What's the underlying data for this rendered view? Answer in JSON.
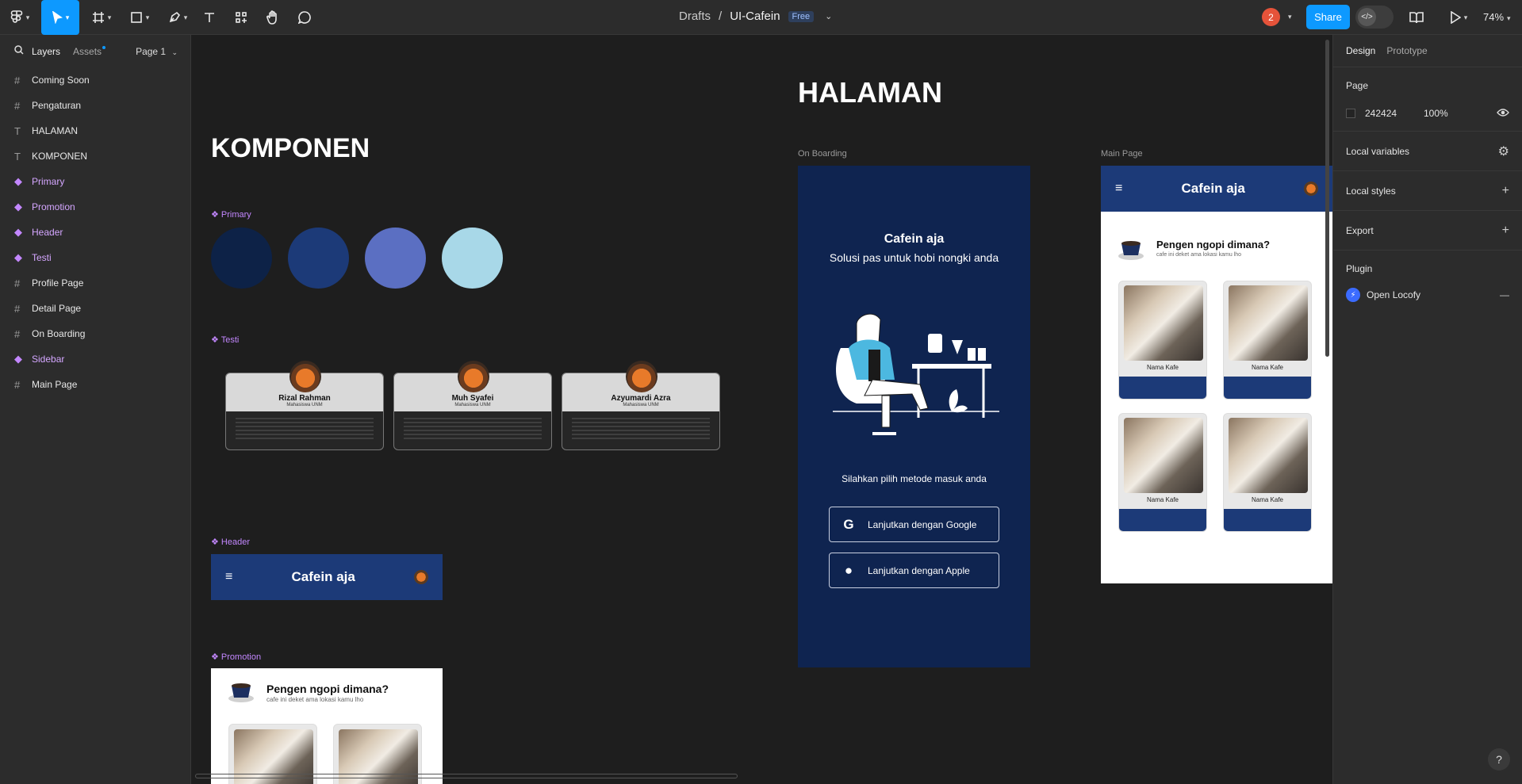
{
  "toolbar": {
    "breadcrumb_folder": "Drafts",
    "breadcrumb_sep": "/",
    "file_name": "UI-Cafein",
    "plan_badge": "Free",
    "collab_count": "2",
    "share_label": "Share",
    "zoom": "74%"
  },
  "left_panel": {
    "tabs": [
      "Layers",
      "Assets"
    ],
    "page": "Page 1",
    "layers": [
      {
        "icon": "#",
        "label": "Coming Soon",
        "kind": "frame"
      },
      {
        "icon": "#",
        "label": "Pengaturan",
        "kind": "frame"
      },
      {
        "icon": "T",
        "label": "HALAMAN",
        "kind": "text"
      },
      {
        "icon": "T",
        "label": "KOMPONEN",
        "kind": "text"
      },
      {
        "icon": "◆",
        "label": "Primary",
        "kind": "component"
      },
      {
        "icon": "◆",
        "label": "Promotion",
        "kind": "component"
      },
      {
        "icon": "◆",
        "label": "Header",
        "kind": "component"
      },
      {
        "icon": "◆",
        "label": "Testi",
        "kind": "component"
      },
      {
        "icon": "#",
        "label": "Profile Page",
        "kind": "frame"
      },
      {
        "icon": "#",
        "label": "Detail Page",
        "kind": "frame"
      },
      {
        "icon": "#",
        "label": "On Boarding",
        "kind": "frame"
      },
      {
        "icon": "◆",
        "label": "Sidebar",
        "kind": "component"
      },
      {
        "icon": "#",
        "label": "Main Page",
        "kind": "frame"
      }
    ]
  },
  "right_panel": {
    "tabs": [
      "Design",
      "Prototype"
    ],
    "page_heading": "Page",
    "page_color": "242424",
    "page_opacity": "100%",
    "local_variables": "Local variables",
    "local_styles": "Local styles",
    "export": "Export",
    "plugin_heading": "Plugin",
    "plugin_name": "Open Locofy"
  },
  "canvas": {
    "halaman_title": "HALAMAN",
    "komponen_title": "KOMPONEN",
    "primary_label": "Primary",
    "primary_colors": [
      "#0d2247",
      "#1c3a78",
      "#5b6fc2",
      "#a8d8e8"
    ],
    "testi_label": "Testi",
    "testi_cards": [
      {
        "name": "Rizal Rahman",
        "role": "Mahasiswa UNM"
      },
      {
        "name": "Muh Syafei",
        "role": "Mahasiswa UNM"
      },
      {
        "name": "Azyumardi Azra",
        "role": "Mahasiswa UNM"
      }
    ],
    "header_label": "Header",
    "header_title": "Cafein aja",
    "promotion_label": "Promotion",
    "promo_title": "Pengen ngopi dimana?",
    "promo_sub": "cafe ini deket ama lokasi kamu lho",
    "onboarding_label": "On Boarding",
    "onboarding_title": "Cafein aja",
    "onboarding_sub": "Solusi pas untuk hobi nongki anda",
    "onboarding_prompt": "Silahkan pilih metode masuk anda",
    "google_btn": "Lanjutkan dengan Google",
    "apple_btn": "Lanjutkan dengan Apple",
    "mainpage_label": "Main Page",
    "mainpage_header": "Cafein aja",
    "cafe_name": "Nama Kafe"
  }
}
